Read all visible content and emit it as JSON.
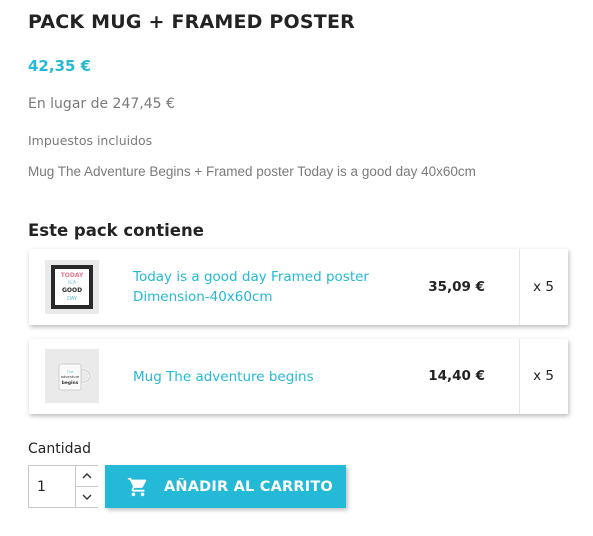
{
  "product": {
    "title": "PACK MUG + FRAMED POSTER",
    "price": "42,35 €",
    "regular_price": "En lugar de 247,45 €",
    "tax_label": "Impuestos incluidos",
    "description": "Mug The Adventure Begins + Framed poster Today is a good day 40x60cm"
  },
  "pack": {
    "heading": "Este pack contiene",
    "items": [
      {
        "name": "Today is a good day Framed poster Dimension-40x60cm",
        "price": "35,09 €",
        "quantity": "x 5",
        "thumbnail_text": [
          "TODAY",
          "IS A",
          "GOOD",
          "DAY"
        ]
      },
      {
        "name": "Mug The adventure begins",
        "price": "14,40 €",
        "quantity": "x 5",
        "thumbnail_text": [
          "The",
          "adventure",
          "begins"
        ]
      }
    ]
  },
  "purchase": {
    "quantity_label": "Cantidad",
    "quantity_value": "1",
    "add_to_cart_label": "AÑADIR AL CARRITO"
  },
  "colors": {
    "accent": "#24b9d7",
    "text": "#232323",
    "muted": "#7a7a7a"
  },
  "icons": {
    "cart": "shopping-cart-icon",
    "increment": "chevron-up-icon",
    "decrement": "chevron-down-icon"
  }
}
